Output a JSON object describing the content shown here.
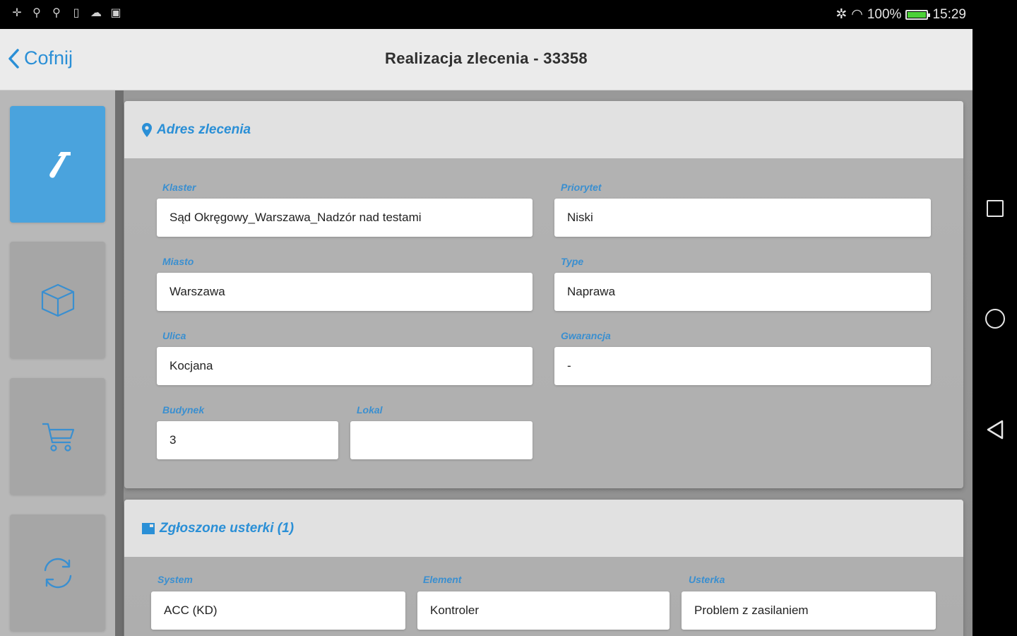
{
  "status_bar": {
    "left_icons": [
      "plus-icon",
      "usb-icon",
      "usb-icon",
      "sim-icon",
      "cloud-icon",
      "image-icon"
    ],
    "battery_percent": "100%",
    "time": "15:29"
  },
  "header": {
    "back_label": "Cofnij",
    "title": "Realizacja zlecenia - 33358"
  },
  "sidebar": {
    "items": [
      {
        "icon": "hammer-icon",
        "active": true
      },
      {
        "icon": "box-icon",
        "active": false
      },
      {
        "icon": "cart-icon",
        "active": false
      },
      {
        "icon": "sync-icon",
        "active": false
      }
    ]
  },
  "address_card": {
    "title": "Adres zlecenia",
    "fields": {
      "klaster": {
        "label": "Klaster",
        "value": "Sąd Okręgowy_Warszawa_Nadzór nad testami"
      },
      "priorytet": {
        "label": "Priorytet",
        "value": "Niski"
      },
      "miasto": {
        "label": "Miasto",
        "value": "Warszawa"
      },
      "type": {
        "label": "Type",
        "value": "Naprawa"
      },
      "ulica": {
        "label": "Ulica",
        "value": "Kocjana"
      },
      "gwarancja": {
        "label": "Gwarancja",
        "value": "-"
      },
      "budynek": {
        "label": "Budynek",
        "value": "3"
      },
      "lokal": {
        "label": "Lokal",
        "value": ""
      }
    }
  },
  "faults_card": {
    "title": "Zgłoszone usterki (1)",
    "fields": {
      "system": {
        "label": "System",
        "value": "ACC (KD)"
      },
      "element": {
        "label": "Element",
        "value": "Kontroler"
      },
      "usterka": {
        "label": "Usterka",
        "value": "Problem z zasilaniem"
      }
    }
  },
  "colors": {
    "accent": "#2a8fd6",
    "active_tab": "#4aa3dd"
  }
}
